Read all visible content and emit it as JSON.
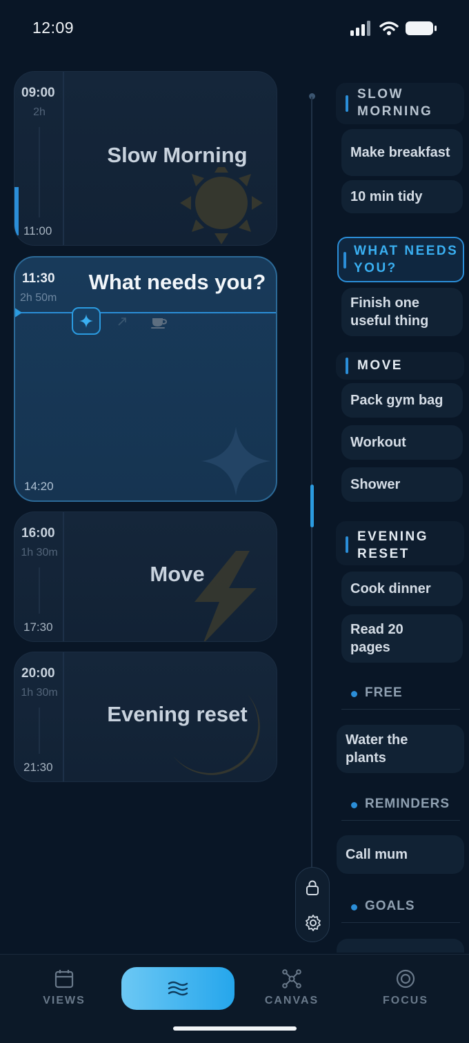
{
  "status": {
    "time": "12:09"
  },
  "schedule": [
    {
      "start": "09:00",
      "duration": "2h",
      "end": "11:00",
      "title": "Slow Morning"
    },
    {
      "start": "11:30",
      "duration": "2h 50m",
      "end": "14:20",
      "title": "What needs you?"
    },
    {
      "start": "16:00",
      "duration": "1h 30m",
      "end": "17:30",
      "title": "Move"
    },
    {
      "start": "20:00",
      "duration": "1h 30m",
      "end": "21:30",
      "title": "Evening reset"
    }
  ],
  "lane": {
    "groups": [
      {
        "title": "SLOW MORNING",
        "items": [
          "Make breakfast",
          "10 min tidy"
        ]
      },
      {
        "title": "WHAT NEEDS YOU?",
        "items": [
          "Finish one useful thing"
        ]
      },
      {
        "title": "MOVE",
        "items": [
          "Pack gym bag",
          "Workout",
          "Shower"
        ]
      },
      {
        "title": "EVENING RESET",
        "items": [
          "Cook dinner",
          "Read 20 pages"
        ]
      }
    ],
    "sections": [
      {
        "title": "FREE",
        "items": [
          "Water the plants"
        ]
      },
      {
        "title": "REMINDERS",
        "items": [
          "Call mum"
        ]
      },
      {
        "title": "GOALS",
        "items": []
      }
    ]
  },
  "nav": {
    "views": "VIEWS",
    "canvas": "CANVAS",
    "focus": "FOCUS"
  },
  "colors": {
    "accent": "#2b9be0",
    "background": "#091626",
    "card": "#15263a",
    "active_card": "#183a5a"
  }
}
